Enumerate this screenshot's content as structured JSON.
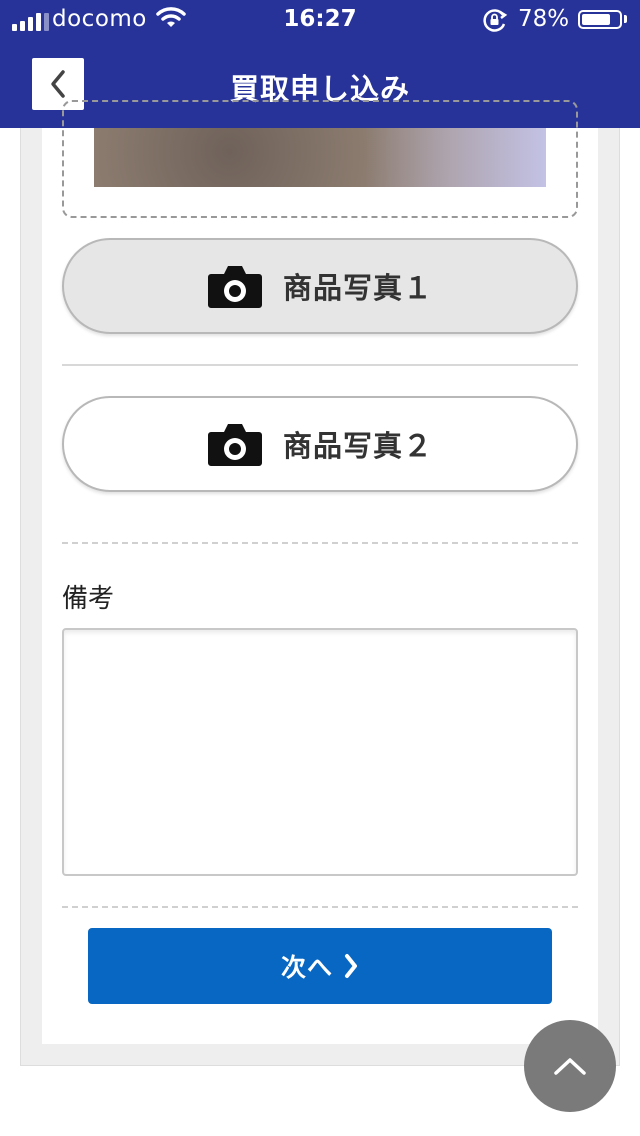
{
  "status_bar": {
    "carrier": "docomo",
    "time": "16:27",
    "battery_percent": "78%",
    "battery_level": 0.78
  },
  "nav": {
    "title": "買取申し込み",
    "back_icon": "chevron-left-icon"
  },
  "photos": [
    {
      "label": "商品写真１",
      "icon": "camera-icon"
    },
    {
      "label": "商品写真２",
      "icon": "camera-icon"
    }
  ],
  "notes": {
    "label": "備考",
    "value": ""
  },
  "next_button": {
    "label": "次へ",
    "icon": "chevron-right-icon"
  },
  "scroll_top": {
    "icon": "chevron-up-icon"
  },
  "colors": {
    "header_bg": "#28339a",
    "primary_button": "#0867c2",
    "page_bg": "#eeeeee"
  }
}
